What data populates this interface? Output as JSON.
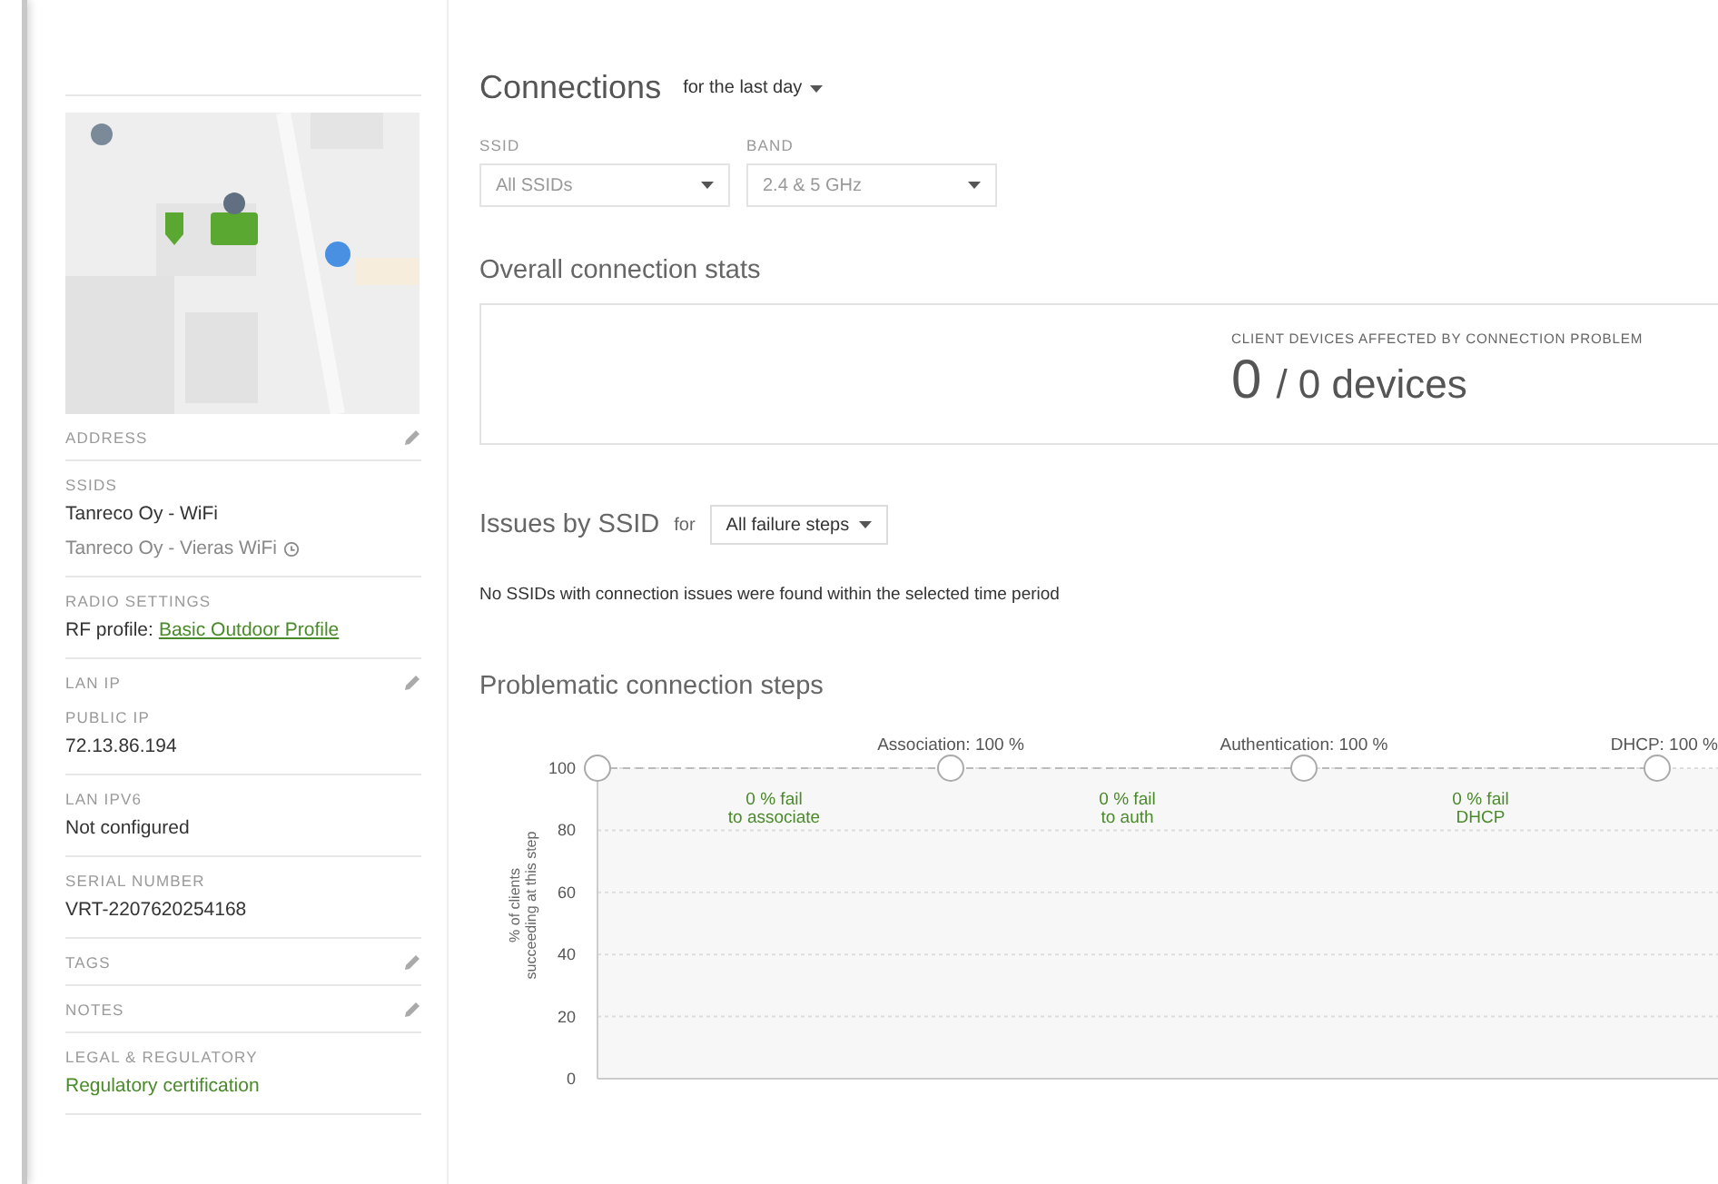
{
  "sidebar": {
    "sections": [
      {
        "fields": [
          {
            "label": "ADDRESS",
            "editable": true
          }
        ]
      },
      {
        "fields": [
          {
            "label": "SSIDS",
            "editable": false,
            "lines": [
              {
                "kind": "text",
                "text": "Tanreco Oy - WiFi"
              },
              {
                "kind": "muted_info",
                "text": "Tanreco Oy - Vieras WiFi"
              }
            ]
          }
        ]
      },
      {
        "fields": [
          {
            "label": "RADIO SETTINGS",
            "editable": false,
            "lines": [
              {
                "kind": "labeled_link",
                "text": "RF profile:",
                "link": "Basic Outdoor Profile"
              }
            ]
          }
        ]
      },
      {
        "fields": [
          {
            "label": "LAN IP",
            "editable": true
          },
          {
            "label": "PUBLIC IP",
            "editable": false,
            "lines": [
              {
                "kind": "text",
                "text": "72.13.86.194"
              }
            ]
          }
        ]
      },
      {
        "fields": [
          {
            "label": "LAN IPV6",
            "editable": false,
            "lines": [
              {
                "kind": "text",
                "text": "Not configured"
              }
            ]
          }
        ]
      },
      {
        "fields": [
          {
            "label": "SERIAL NUMBER",
            "editable": false,
            "lines": [
              {
                "kind": "text",
                "text": "VRT-2207620254168"
              }
            ]
          }
        ]
      },
      {
        "fields": [
          {
            "label": "TAGS",
            "editable": true
          }
        ]
      },
      {
        "fields": [
          {
            "label": "NOTES",
            "editable": true
          }
        ]
      },
      {
        "fields": [
          {
            "label": "LEGAL & REGULATORY",
            "editable": false,
            "lines": [
              {
                "kind": "link",
                "text": "Regulatory certification"
              }
            ]
          }
        ]
      }
    ]
  },
  "connections": {
    "title": "Connections",
    "period": "for the last day",
    "filters": [
      {
        "label": "SSID",
        "value": "All SSIDs"
      },
      {
        "label": "BAND",
        "value": "2.4 & 5 GHz"
      }
    ]
  },
  "overall": {
    "title": "Overall connection stats",
    "caption": "CLIENT DEVICES AFFECTED BY CONNECTION PROBLEM",
    "count": "0",
    "total": "/ 0 devices"
  },
  "issues": {
    "title": "Issues by SSID",
    "for": "for",
    "filter": "All failure steps",
    "message": "No SSIDs with connection issues were found within the selected time period"
  },
  "steps": {
    "title": "Problematic connection steps",
    "step_labels": [
      "Association: 100 %",
      "Authentication: 100 %",
      "DHCP: 100 %"
    ],
    "fail_labels": [
      [
        "0 % fail",
        "to associate"
      ],
      [
        "0 % fail",
        "to auth"
      ],
      [
        "0 % fail",
        "DHCP"
      ]
    ],
    "chart_data": {
      "type": "line",
      "grid": true,
      "ylabel": "% of clients succeeding at this step",
      "ylim": [
        0,
        100
      ],
      "yticks": [
        0,
        20,
        40,
        60,
        80,
        100
      ],
      "series": [
        {
          "color": "#bbbbbb",
          "line_style": "dashed",
          "marker": "circle",
          "values": [
            100,
            100,
            100,
            100
          ]
        }
      ]
    }
  }
}
